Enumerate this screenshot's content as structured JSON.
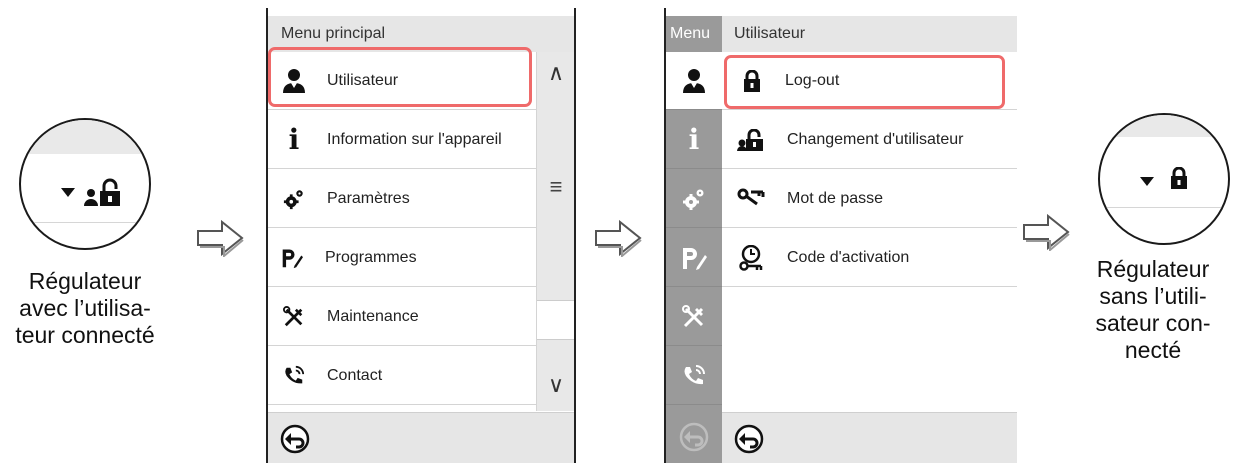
{
  "left_caption": [
    "Régulateur",
    "avec l’utilisa-",
    "teur connecté"
  ],
  "right_caption": [
    "Régulateur",
    "sans l’utili-",
    "sateur con-",
    "necté"
  ],
  "screen1": {
    "title": "Menu principal",
    "items": [
      {
        "label": "Utilisateur",
        "icon": "user-icon"
      },
      {
        "label": "Information sur l'appareil",
        "icon": "info-icon"
      },
      {
        "label": "Paramètres",
        "icon": "gears-icon"
      },
      {
        "label": "Programmes",
        "icon": "program-icon"
      },
      {
        "label": "Maintenance",
        "icon": "tools-icon"
      },
      {
        "label": "Contact",
        "icon": "phone-icon"
      }
    ],
    "scroll_up": "∧",
    "scroll_mid": "≡",
    "scroll_down": "∨"
  },
  "screen2": {
    "rail_title": "Menu",
    "title": "Utilisateur",
    "items": [
      {
        "label": "Log-out",
        "icon": "lock-icon"
      },
      {
        "label": "Changement d'utilisateur",
        "icon": "user-switch-icon"
      },
      {
        "label": "Mot de passe",
        "icon": "key-icon"
      },
      {
        "label": "Code d'activation",
        "icon": "activation-code-icon"
      }
    ]
  },
  "colors": {
    "highlight": "#ef6a6a",
    "rail": "#9a9a9a",
    "header": "#e6e6e6"
  }
}
